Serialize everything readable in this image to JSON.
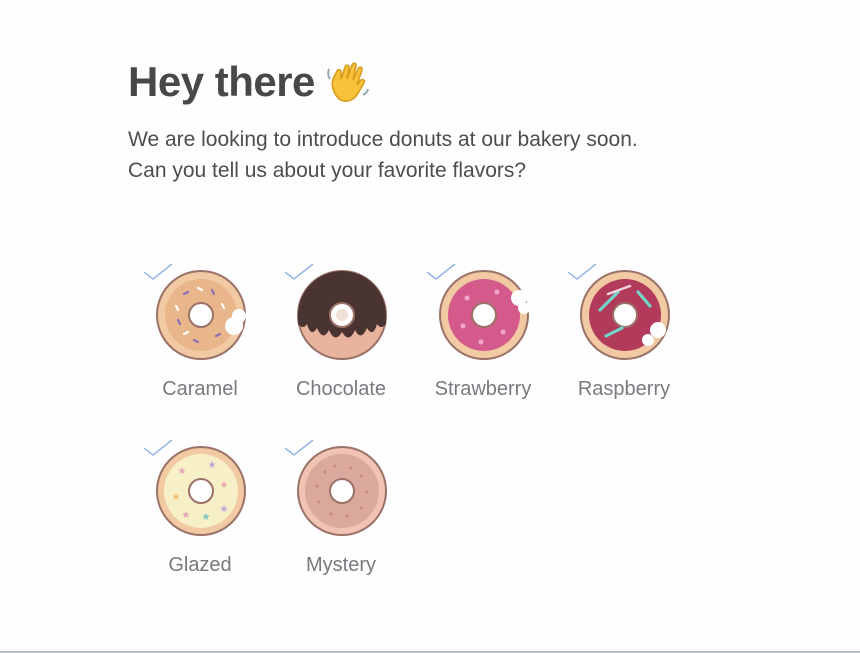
{
  "greeting": {
    "title": "Hey there",
    "emoji_icon": "waving-hand-icon"
  },
  "intro": {
    "line1": "We are looking to introduce donuts at our bakery soon.",
    "line2": "Can you tell us about your favorite flavors?"
  },
  "options": [
    {
      "label": "Caramel",
      "icon": "caramel-donut-icon",
      "glaze": "#e8b68a",
      "checked": true
    },
    {
      "label": "Chocolate",
      "icon": "chocolate-donut-icon",
      "glaze": "#4a3432",
      "checked": true
    },
    {
      "label": "Strawberry",
      "icon": "strawberry-donut-icon",
      "glaze": "#d45a8c",
      "checked": true
    },
    {
      "label": "Raspberry",
      "icon": "raspberry-donut-icon",
      "glaze": "#b23a5a",
      "checked": true
    },
    {
      "label": "Glazed",
      "icon": "glazed-donut-icon",
      "glaze": "#f7efc6",
      "checked": true
    },
    {
      "label": "Mystery",
      "icon": "mystery-donut-icon",
      "glaze": "#dba89e",
      "checked": true
    }
  ],
  "colors": {
    "check": "#9ab8e6",
    "dough": "#f1c9a3",
    "outline": "#9b7267"
  }
}
